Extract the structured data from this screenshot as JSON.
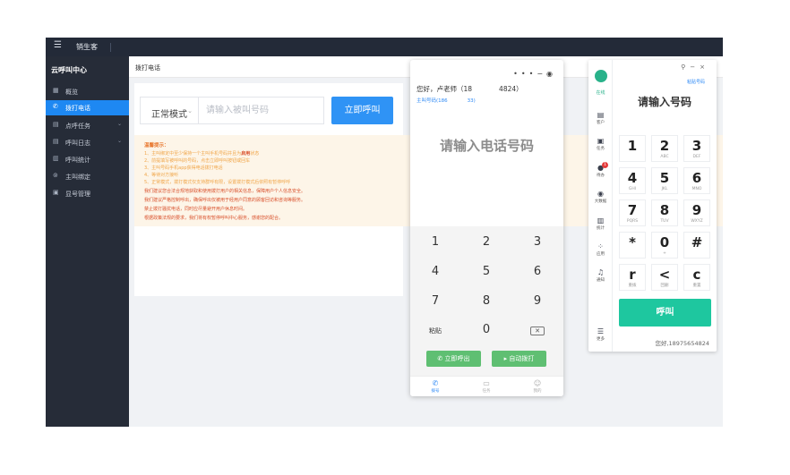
{
  "topbar": {
    "menu_icon": "hamburger-icon",
    "app_name": "销生客"
  },
  "sidebar": {
    "title": "云呼叫中心",
    "items": [
      {
        "label": "概览",
        "icon": "grid-icon",
        "active": false,
        "has_chevron": false
      },
      {
        "label": "拨打电话",
        "icon": "phone-icon",
        "active": true,
        "has_chevron": false
      },
      {
        "label": "点呼任务",
        "icon": "task-icon",
        "active": false,
        "has_chevron": true
      },
      {
        "label": "呼叫日志",
        "icon": "log-icon",
        "active": false,
        "has_chevron": true
      },
      {
        "label": "呼叫统计",
        "icon": "bar-chart-icon",
        "active": false,
        "has_chevron": false
      },
      {
        "label": "主叫绑定",
        "icon": "bind-icon",
        "active": false,
        "has_chevron": false
      },
      {
        "label": "显号管理",
        "icon": "manage-icon",
        "active": false,
        "has_chevron": false
      }
    ]
  },
  "main": {
    "title": "拨打电话",
    "mode_select": "正常模式",
    "number_placeholder": "请输入被叫号码",
    "call_button": "立即呼叫",
    "notice": {
      "heading": "温馨提示：",
      "tips_prefix": "1、主叫绑定中至少保持一个主叫手机号码并且为",
      "tips_highlight": "启用",
      "tips_suffix": "状态",
      "tips": [
        "2、前提填写被呼叫的号码，点击立即呼叫按钮或回车",
        "3、主叫号码手机app获得电话拨打电话",
        "4、等待对方接听",
        "5、正常模式，拨打模式仅支持群呼有限，设置拨打模式后依照有暂停呼呼"
      ],
      "warnings": [
        "我们建议您合法合规地获取和使用拨打用户的相关信息，保障用户个人信息安全。",
        "我们建议严格控制呼出，确保呼出仅被用于经用户同意的顾客回访和咨询等服务。",
        "禁止拨打骚扰电话，同时应尽量避开用户休息时间。",
        "根据政策法规的要求，我们将有权暂停呼叫中心服务，感谢您的配合。"
      ]
    }
  },
  "widget": {
    "greeting": "您好，卢老师（18　　　　4824）",
    "main_number": "主叫号码(186　　　　33)",
    "prompt": "请输入电话号码",
    "keys": [
      "1",
      "2",
      "3",
      "4",
      "5",
      "6",
      "7",
      "8",
      "9",
      "粘贴",
      "0"
    ],
    "delete_icon": "backspace-icon",
    "call_now": "立即呼出",
    "auto_dial": "自动拨打",
    "tabs": [
      {
        "label": "拨号",
        "icon": "phone-icon",
        "active": true
      },
      {
        "label": "任务",
        "icon": "task-icon",
        "active": false
      },
      {
        "label": "我的",
        "icon": "user-icon",
        "active": false
      }
    ]
  },
  "dialer": {
    "status": "在线",
    "nav": [
      {
        "label": "客户",
        "icon": "customer-icon"
      },
      {
        "label": "任务",
        "icon": "task-icon"
      },
      {
        "label": "待办",
        "icon": "todo-icon",
        "badge": "1"
      },
      {
        "label": "大数据",
        "icon": "location-icon"
      },
      {
        "label": "统计",
        "icon": "stats-icon"
      },
      {
        "label": "应用",
        "icon": "apps-icon"
      },
      {
        "label": "通知",
        "icon": "bell-icon"
      },
      {
        "label": "更多",
        "icon": "menu-icon"
      }
    ],
    "paste": "粘贴号码",
    "prompt": "请输入号码",
    "keys": [
      {
        "main": "1",
        "sub": ""
      },
      {
        "main": "2",
        "sub": "ABC"
      },
      {
        "main": "3",
        "sub": "DEF"
      },
      {
        "main": "4",
        "sub": "GHI"
      },
      {
        "main": "5",
        "sub": "JKL"
      },
      {
        "main": "6",
        "sub": "MNO"
      },
      {
        "main": "7",
        "sub": "PQRS"
      },
      {
        "main": "8",
        "sub": "TUV"
      },
      {
        "main": "9",
        "sub": "WXYZ"
      },
      {
        "main": "*",
        "sub": ""
      },
      {
        "main": "0",
        "sub": "+"
      },
      {
        "main": "#",
        "sub": ""
      },
      {
        "main": "r",
        "sub": "重拨"
      },
      {
        "main": "<",
        "sub": "回删"
      },
      {
        "main": "c",
        "sub": "重置"
      }
    ],
    "call": "呼叫",
    "user": "您好,18975654824"
  },
  "colors": {
    "accent": "#1e88f2",
    "sidebar": "#262c38",
    "call_green": "#1ec79f",
    "widget_green": "#5fbf72"
  }
}
